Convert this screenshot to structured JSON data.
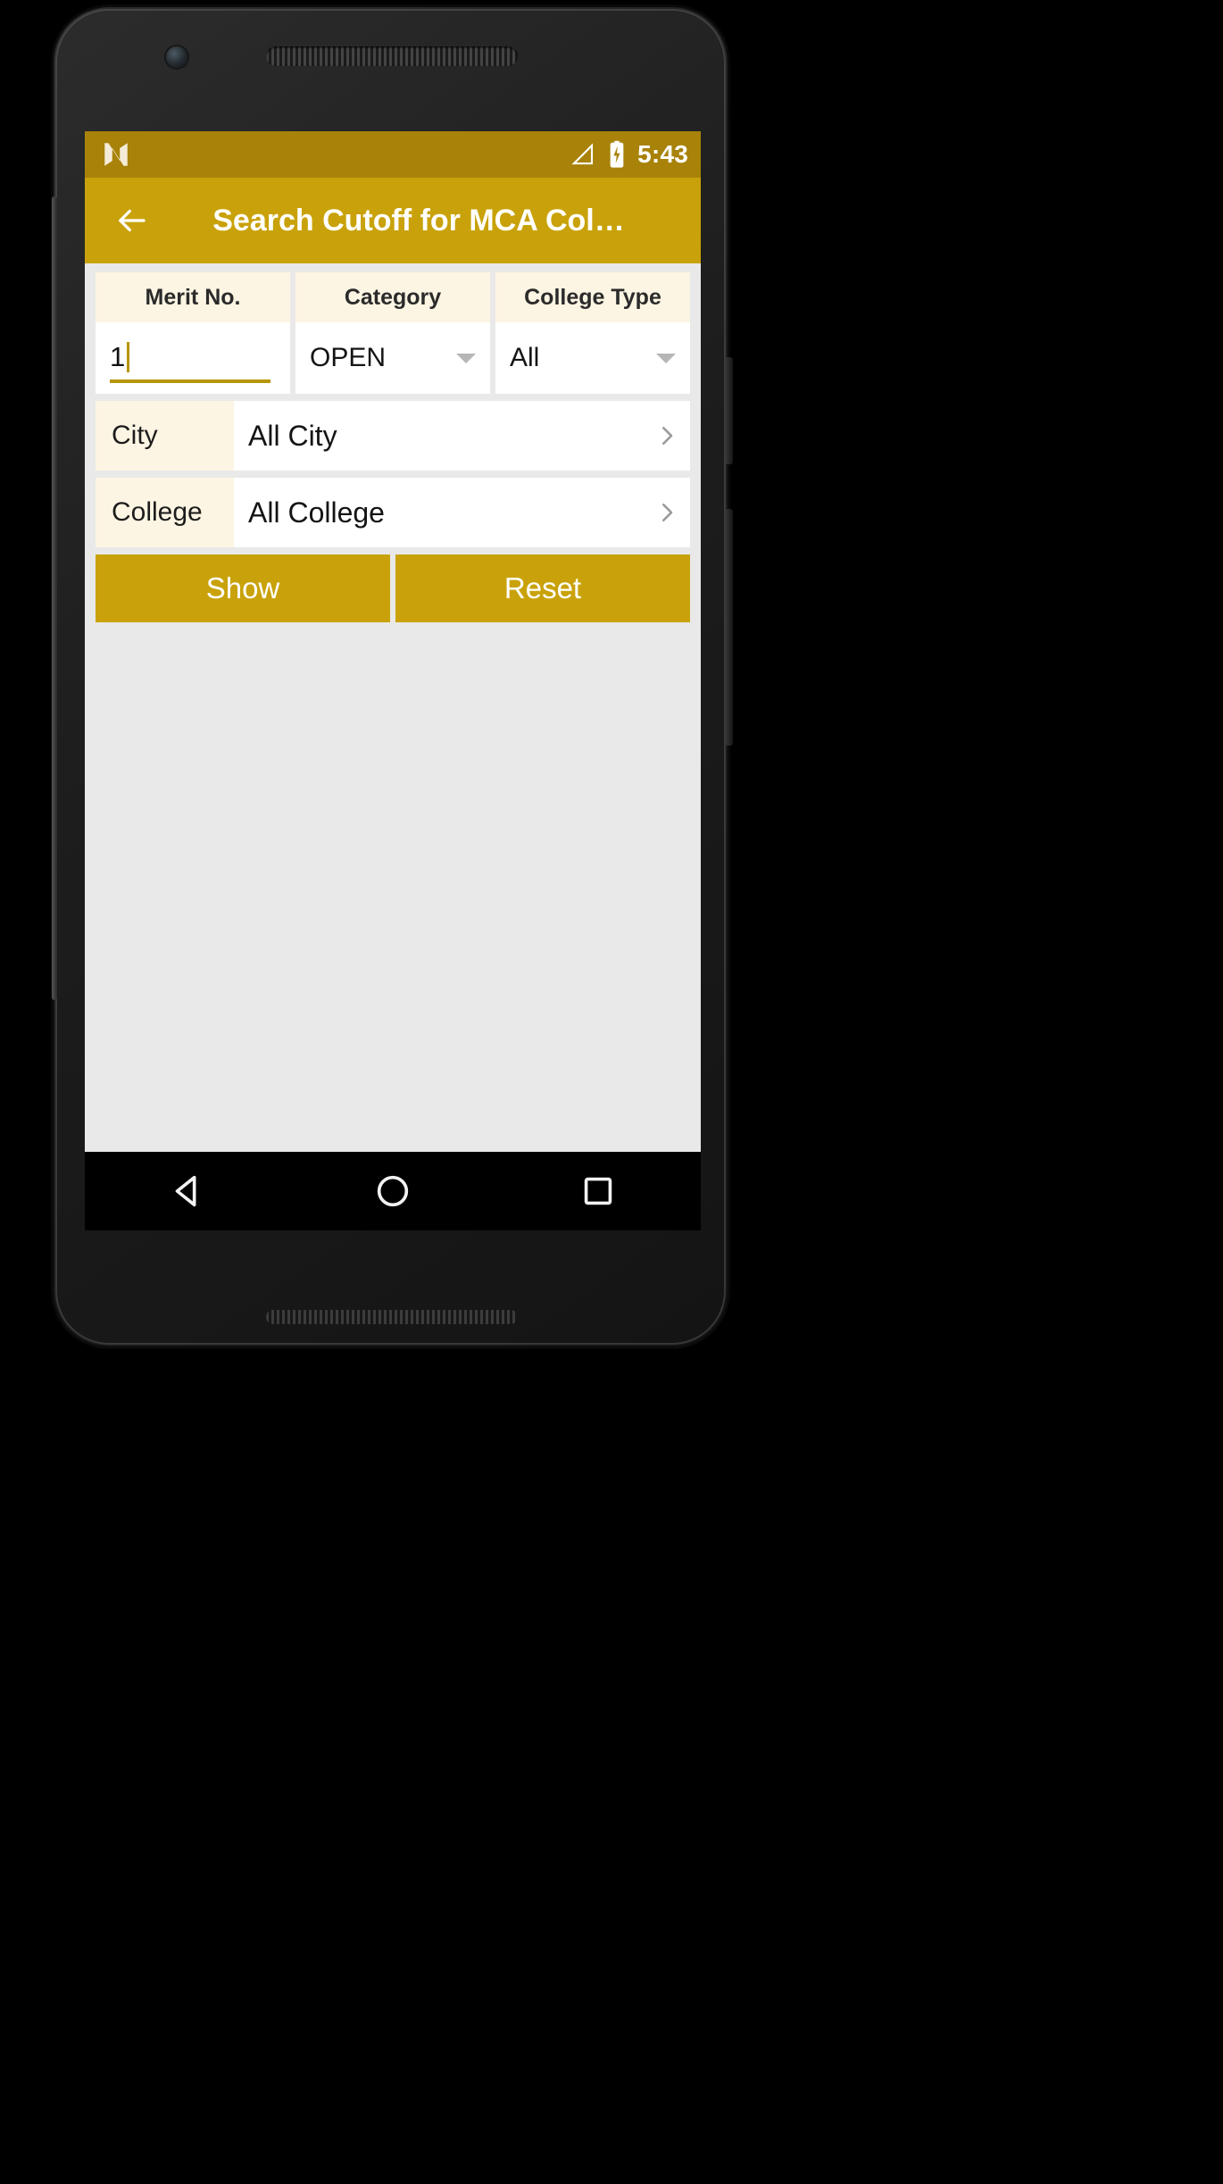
{
  "theme": {
    "status_bar_color": "#a88209",
    "app_bar_color": "#c9a20b",
    "accent_color": "#b8960a",
    "header_cell_color": "#fdf5e3",
    "content_bg_color": "#e9e9e9",
    "nav_bar_color": "#000000"
  },
  "status_bar": {
    "os_logo": "android-n-logo",
    "signal_icon": "signal-triangle-icon",
    "battery_icon": "battery-charging-icon",
    "clock": "5:43"
  },
  "app_bar": {
    "back_icon": "back-arrow-icon",
    "title": "Search Cutoff for MCA Col…"
  },
  "form": {
    "columns": [
      {
        "header": "Merit No.",
        "type": "text-input",
        "value": "1",
        "placeholder": ""
      },
      {
        "header": "Category",
        "type": "dropdown",
        "value": "OPEN",
        "caret_icon": "chevron-down-icon"
      },
      {
        "header": "College Type",
        "type": "dropdown",
        "value": "All",
        "caret_icon": "chevron-down-icon"
      }
    ],
    "pickers": [
      {
        "label": "City",
        "value": "All City",
        "chevron_icon": "chevron-right-icon"
      },
      {
        "label": "College",
        "value": "All College",
        "chevron_icon": "chevron-right-icon"
      }
    ],
    "buttons": [
      {
        "label": "Show"
      },
      {
        "label": "Reset"
      }
    ]
  },
  "nav_bar": {
    "back": "nav-back-triangle-icon",
    "home": "nav-home-circle-icon",
    "recents": "nav-recents-square-icon"
  }
}
